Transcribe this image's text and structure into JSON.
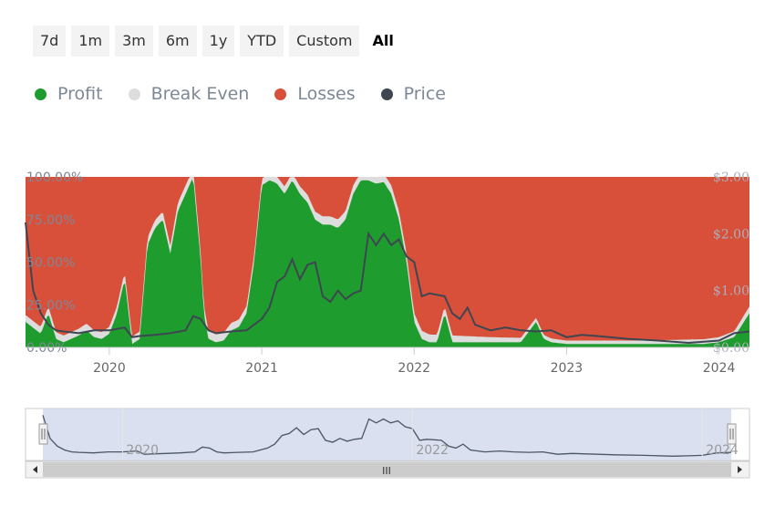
{
  "range_selector": {
    "buttons": [
      "7d",
      "1m",
      "3m",
      "6m",
      "1y",
      "YTD",
      "Custom",
      "All"
    ],
    "active": "All"
  },
  "legend": [
    {
      "label": "Profit",
      "color": "#1f9c2e"
    },
    {
      "label": "Break Even",
      "color": "#dddddd"
    },
    {
      "label": "Losses",
      "color": "#d9503a"
    },
    {
      "label": "Price",
      "color": "#3d4651"
    }
  ],
  "chart_data": {
    "type": "area",
    "title": "",
    "x_ticks": [
      "2020",
      "2021",
      "2022",
      "2023",
      "2024"
    ],
    "x_range": [
      2019.45,
      2024.2
    ],
    "y_left_ticks": [
      "100.00%",
      "75.00%",
      "50.00%",
      "25.00%",
      "0.00%"
    ],
    "y_left_range": [
      0,
      100
    ],
    "y_right_ticks": [
      "$3.00",
      "$2.00",
      "$1.00",
      "$0.00"
    ],
    "y_right_range": [
      0,
      3
    ],
    "stacking": "percent",
    "series": [
      {
        "name": "Profit",
        "color": "#1f9c2e",
        "x": [
          2019.45,
          2019.55,
          2019.6,
          2019.65,
          2019.7,
          2019.8,
          2019.85,
          2019.9,
          2019.95,
          2020.0,
          2020.05,
          2020.1,
          2020.15,
          2020.2,
          2020.25,
          2020.3,
          2020.35,
          2020.4,
          2020.45,
          2020.5,
          2020.55,
          2020.6,
          2020.62,
          2020.65,
          2020.7,
          2020.75,
          2020.8,
          2020.85,
          2020.9,
          2020.95,
          2021.0,
          2021.05,
          2021.08,
          2021.1,
          2021.15,
          2021.2,
          2021.25,
          2021.3,
          2021.35,
          2021.4,
          2021.45,
          2021.5,
          2021.55,
          2021.6,
          2021.65,
          2021.7,
          2021.75,
          2021.8,
          2021.85,
          2021.9,
          2021.95,
          2022.0,
          2022.05,
          2022.1,
          2022.15,
          2022.2,
          2022.25,
          2022.3,
          2022.35,
          2022.4,
          2022.5,
          2022.6,
          2022.7,
          2022.8,
          2022.85,
          2022.9,
          2023.0,
          2023.2,
          2023.4,
          2023.6,
          2023.8,
          2023.9,
          2024.0,
          2024.1,
          2024.2
        ],
        "y": [
          15,
          8,
          20,
          5,
          3,
          7,
          10,
          6,
          5,
          8,
          20,
          40,
          2,
          5,
          60,
          70,
          75,
          55,
          80,
          90,
          100,
          50,
          20,
          5,
          3,
          4,
          10,
          12,
          20,
          50,
          95,
          98,
          97,
          96,
          90,
          98,
          90,
          85,
          75,
          72,
          72,
          70,
          75,
          90,
          98,
          98,
          96,
          97,
          90,
          75,
          50,
          15,
          5,
          3,
          3,
          20,
          3,
          3,
          3,
          3,
          3,
          3,
          3,
          15,
          5,
          3,
          2,
          2,
          2,
          2,
          2,
          2,
          3,
          6,
          20
        ]
      },
      {
        "name": "Break Even",
        "color": "#dddddd",
        "x": [
          2019.45,
          2020.0,
          2020.5,
          2021.0,
          2021.5,
          2022.0,
          2022.5,
          2023.0,
          2023.5,
          2024.0,
          2024.2
        ],
        "y": [
          4,
          4,
          5,
          4,
          5,
          5,
          3,
          2,
          2,
          3,
          4
        ]
      },
      {
        "name": "Losses",
        "color": "#d9503a",
        "x": [
          2019.45,
          2024.2
        ],
        "y": [
          81,
          76
        ]
      },
      {
        "name": "Price",
        "color": "#3d4651",
        "axis": "right",
        "x": [
          2019.45,
          2019.5,
          2019.55,
          2019.6,
          2019.65,
          2019.7,
          2019.8,
          2019.9,
          2020.0,
          2020.1,
          2020.15,
          2020.2,
          2020.3,
          2020.4,
          2020.5,
          2020.55,
          2020.6,
          2020.65,
          2020.7,
          2020.8,
          2020.9,
          2021.0,
          2021.05,
          2021.1,
          2021.15,
          2021.2,
          2021.25,
          2021.3,
          2021.35,
          2021.4,
          2021.45,
          2021.5,
          2021.55,
          2021.6,
          2021.65,
          2021.7,
          2021.75,
          2021.8,
          2021.85,
          2021.9,
          2021.95,
          2022.0,
          2022.05,
          2022.1,
          2022.2,
          2022.25,
          2022.3,
          2022.35,
          2022.4,
          2022.5,
          2022.6,
          2022.7,
          2022.8,
          2022.9,
          2023.0,
          2023.1,
          2023.2,
          2023.4,
          2023.6,
          2023.8,
          2023.9,
          2024.0,
          2024.1,
          2024.2
        ],
        "y": [
          2.2,
          1.0,
          0.6,
          0.4,
          0.3,
          0.28,
          0.25,
          0.3,
          0.3,
          0.35,
          0.18,
          0.2,
          0.22,
          0.25,
          0.3,
          0.55,
          0.5,
          0.3,
          0.25,
          0.28,
          0.3,
          0.5,
          0.7,
          1.15,
          1.25,
          1.55,
          1.2,
          1.45,
          1.5,
          0.9,
          0.8,
          1.0,
          0.85,
          0.95,
          1.0,
          2.0,
          1.8,
          2.0,
          1.8,
          1.9,
          1.6,
          1.5,
          0.9,
          0.95,
          0.9,
          0.6,
          0.5,
          0.7,
          0.4,
          0.3,
          0.35,
          0.3,
          0.28,
          0.3,
          0.18,
          0.22,
          0.2,
          0.15,
          0.12,
          0.08,
          0.1,
          0.12,
          0.25,
          0.28
        ]
      }
    ],
    "navigator": {
      "x_ticks": [
        "2020",
        "2022",
        "2024"
      ],
      "scrollbar_label": "III"
    }
  }
}
